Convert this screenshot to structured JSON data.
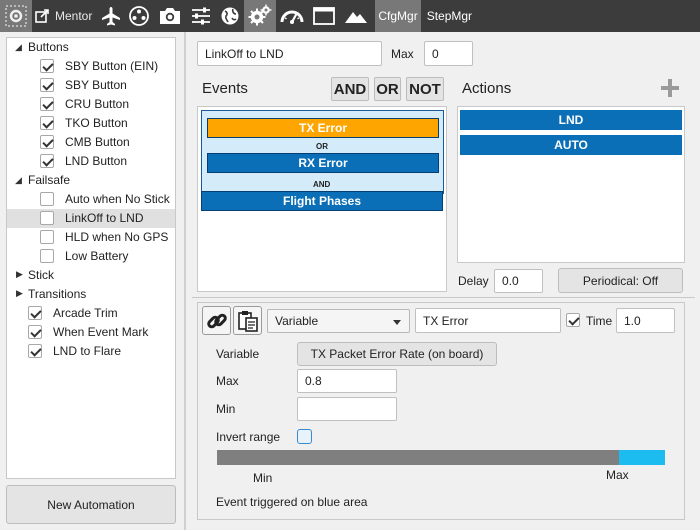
{
  "toolbar": {
    "mentor_label": "Mentor",
    "tabs": [
      {
        "label": "CfgMgr",
        "active": true
      },
      {
        "label": "StepMgr",
        "active": false
      }
    ],
    "icons": [
      "settings-icon",
      "external-link-icon",
      "airplane-icon",
      "joystick-icon",
      "camera-icon",
      "sliders-icon",
      "globe-icon",
      "gears-icon",
      "gauge-icon",
      "window-icon",
      "mountains-icon"
    ]
  },
  "tree": {
    "nodes": [
      {
        "label": "Buttons",
        "type": "group",
        "expanded": true
      },
      {
        "label": "SBY Button (EIN)",
        "type": "item",
        "checked": true
      },
      {
        "label": "SBY Button",
        "type": "item",
        "checked": true
      },
      {
        "label": "CRU Button",
        "type": "item",
        "checked": true
      },
      {
        "label": "TKO Button",
        "type": "item",
        "checked": true
      },
      {
        "label": "CMB Button",
        "type": "item",
        "checked": true
      },
      {
        "label": "LND Button",
        "type": "item",
        "checked": true
      },
      {
        "label": "Failsafe",
        "type": "group",
        "expanded": true
      },
      {
        "label": "Auto when No Stick",
        "type": "item",
        "checked": false
      },
      {
        "label": "LinkOff to LND",
        "type": "item",
        "checked": false,
        "selected": true
      },
      {
        "label": "HLD when No GPS",
        "type": "item",
        "checked": false
      },
      {
        "label": "Low Battery",
        "type": "item",
        "checked": false
      },
      {
        "label": "Stick",
        "type": "group",
        "expanded": false
      },
      {
        "label": "Transitions",
        "type": "group",
        "expanded": true
      },
      {
        "label": "Arcade Trim",
        "type": "item",
        "checked": true
      },
      {
        "label": "When Event Mark",
        "type": "item",
        "checked": true
      },
      {
        "label": "LND to Flare",
        "type": "item",
        "checked": true
      }
    ],
    "new_automation_label": "New Automation"
  },
  "automation": {
    "name": "LinkOff to LND",
    "max_label": "Max",
    "max_value": "0"
  },
  "events": {
    "title": "Events",
    "ops": [
      "AND",
      "OR",
      "NOT"
    ],
    "group": {
      "first": "TX Error",
      "operator": "OR",
      "second": "RX Error"
    },
    "join_operator": "AND",
    "last": "Flight Phases"
  },
  "actions": {
    "title": "Actions",
    "items": [
      "LND",
      "AUTO"
    ],
    "delay_label": "Delay",
    "delay_value": "0.0",
    "periodical_label": "Periodical: Off"
  },
  "condition": {
    "type_selected": "Variable",
    "event_name": "TX Error",
    "time_label": "Time",
    "time_checked": true,
    "time_value": "1.0",
    "variable_label": "Variable",
    "variable_value": "TX Packet Error Rate (on board)",
    "max_label": "Max",
    "max_value": "0.8",
    "min_label": "Min",
    "min_value": "",
    "invert_label": "Invert range",
    "invert_checked": false,
    "range_min_label": "Min",
    "range_max_label": "Max",
    "footer": "Event triggered on blue area"
  },
  "colors": {
    "event_orange": "#ffa500",
    "event_blue": "#0a6fb6",
    "group_bg": "#d4ecfa",
    "range_blue": "#1cbcf0",
    "range_gray": "#7f7f7f"
  }
}
